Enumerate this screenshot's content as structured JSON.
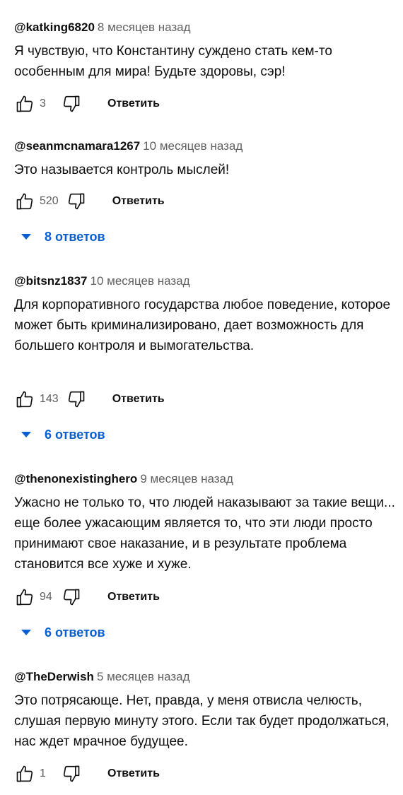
{
  "reply_label": "Ответить",
  "colors": {
    "link": "#065fd4",
    "meta": "#606060",
    "text": "#0f0f0f"
  },
  "comments": [
    {
      "author": "@katking6820",
      "time": "8 месяцев назад",
      "text": "Я чувствую, что Константину суждено стать кем-то особенным для мира! Будьте здоровы, сэр!",
      "likes": "3"
    },
    {
      "author": "@seanmcnamara1267",
      "time": "10 месяцев назад",
      "text": "Это называется контроль мыслей!",
      "likes": "520",
      "replies": "8 ответов"
    },
    {
      "author": "@bitsnz1837",
      "time": "10 месяцев назад",
      "text": "Для корпоративного государства любое поведение, которое может быть криминализировано, дает возможность для большего контроля и вымогательства.",
      "likes": "143",
      "replies": "6 ответов"
    },
    {
      "author": "@thenonexistinghero",
      "time": "9 месяцев назад",
      "text": "Ужасно не только то, что людей наказывают за такие вещи... еще более ужасающим является то, что эти люди просто принимают свое наказание, и в результате проблема становится все хуже и хуже.",
      "likes": "94",
      "replies": "6 ответов"
    },
    {
      "author": "@TheDerwish",
      "time": "5 месяцев назад",
      "text": "Это потрясающе. Нет, правда, у меня отвисла челюсть, слушая первую минуту этого. Если так будет продолжаться, нас ждет мрачное будущее.",
      "likes": "1"
    }
  ]
}
